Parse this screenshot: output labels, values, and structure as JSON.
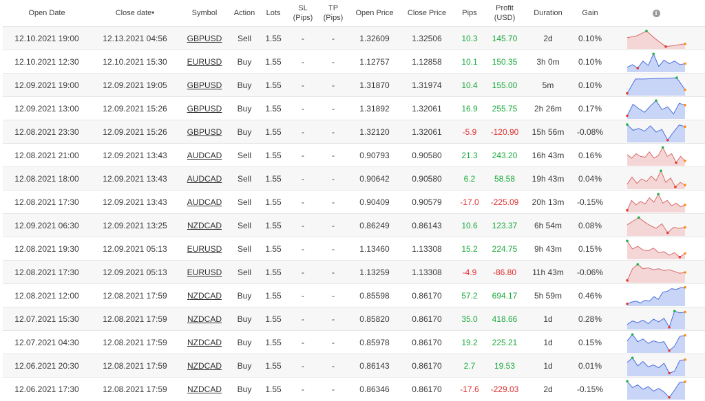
{
  "headers": {
    "open_date": "Open Date",
    "close_date": "Close date",
    "sort_arrow": "▾",
    "symbol": "Symbol",
    "action": "Action",
    "lots": "Lots",
    "sl_1": "SL",
    "sl_2": "(Pips)",
    "tp_1": "TP",
    "tp_2": "(Pips)",
    "open_price": "Open Price",
    "close_price": "Close Price",
    "pips": "Pips",
    "profit_1": "Profit",
    "profit_2": "(USD)",
    "duration": "Duration",
    "gain": "Gain",
    "info_icon": "i"
  },
  "colors": {
    "positive": "#1aaa3c",
    "negative": "#e03030",
    "spark_up_line": "#4a6ee0",
    "spark_up_fill": "#c8d5f7",
    "spark_down_line": "#d86a6a",
    "spark_down_fill": "#f5d6d6"
  },
  "rows": [
    {
      "open": "12.10.2021 19:00",
      "close": "12.13.2021 04:56",
      "symbol": "GBPUSD",
      "action": "Sell",
      "lots": "1.55",
      "sl": "-",
      "tp": "-",
      "open_price": "1.32609",
      "close_price": "1.32506",
      "pips": "10.3",
      "profit": "145.70",
      "duration": "2d",
      "gain": "0.10%",
      "trend": "down",
      "spark": [
        0.55,
        0.65,
        0.92,
        0.45,
        0.05,
        0.12,
        0.2
      ]
    },
    {
      "open": "12.10.2021 12:30",
      "close": "12.10.2021 15:30",
      "symbol": "EURUSD",
      "action": "Buy",
      "lots": "1.55",
      "sl": "-",
      "tp": "-",
      "open_price": "1.12757",
      "close_price": "1.12858",
      "pips": "10.1",
      "profit": "150.35",
      "duration": "3h 0m",
      "gain": "0.10%",
      "trend": "up",
      "spark": [
        0.2,
        0.35,
        0.15,
        0.55,
        0.3,
        0.95,
        0.25,
        0.6,
        0.4,
        0.55,
        0.35,
        0.4
      ]
    },
    {
      "open": "12.09.2021 19:00",
      "close": "12.09.2021 19:05",
      "symbol": "GBPUSD",
      "action": "Buy",
      "lots": "1.55",
      "sl": "-",
      "tp": "-",
      "open_price": "1.31870",
      "close_price": "1.31974",
      "pips": "10.4",
      "profit": "155.00",
      "duration": "5m",
      "gain": "0.10%",
      "trend": "up",
      "spark": [
        0.05,
        0.85,
        0.85,
        0.87,
        0.88,
        0.9,
        0.92,
        0.25
      ]
    },
    {
      "open": "12.09.2021 13:00",
      "close": "12.09.2021 15:26",
      "symbol": "GBPUSD",
      "action": "Buy",
      "lots": "1.55",
      "sl": "-",
      "tp": "-",
      "open_price": "1.31892",
      "close_price": "1.32061",
      "pips": "16.9",
      "profit": "255.75",
      "duration": "2h 26m",
      "gain": "0.17%",
      "trend": "up",
      "spark": [
        0.1,
        0.75,
        0.5,
        0.3,
        0.65,
        0.95,
        0.45,
        0.6,
        0.2,
        0.8,
        0.7
      ]
    },
    {
      "open": "12.08.2021 23:30",
      "close": "12.09.2021 15:26",
      "symbol": "GBPUSD",
      "action": "Buy",
      "lots": "1.55",
      "sl": "-",
      "tp": "-",
      "open_price": "1.32120",
      "close_price": "1.32061",
      "pips": "-5.9",
      "profit": "-120.90",
      "duration": "15h 56m",
      "gain": "-0.08%",
      "trend": "up",
      "spark": [
        0.92,
        0.6,
        0.7,
        0.55,
        0.85,
        0.5,
        0.65,
        0.05,
        0.5,
        0.9,
        0.8
      ]
    },
    {
      "open": "12.08.2021 21:00",
      "close": "12.09.2021 13:43",
      "symbol": "AUDCAD",
      "action": "Sell",
      "lots": "1.55",
      "sl": "-",
      "tp": "-",
      "open_price": "0.90793",
      "close_price": "0.90580",
      "pips": "21.3",
      "profit": "243.20",
      "duration": "16h 43m",
      "gain": "0.16%",
      "trend": "down",
      "spark": [
        0.55,
        0.35,
        0.6,
        0.45,
        0.4,
        0.7,
        0.35,
        0.5,
        0.95,
        0.45,
        0.6,
        0.1,
        0.45,
        0.2
      ]
    },
    {
      "open": "12.08.2021 18:00",
      "close": "12.09.2021 13:43",
      "symbol": "AUDCAD",
      "action": "Sell",
      "lots": "1.55",
      "sl": "-",
      "tp": "-",
      "open_price": "0.90642",
      "close_price": "0.90580",
      "pips": "6.2",
      "profit": "58.58",
      "duration": "19h 43m",
      "gain": "0.04%",
      "trend": "down",
      "spark": [
        0.2,
        0.6,
        0.25,
        0.5,
        0.35,
        0.65,
        0.4,
        0.95,
        0.3,
        0.55,
        0.05,
        0.3,
        0.15
      ]
    },
    {
      "open": "12.08.2021 17:30",
      "close": "12.09.2021 13:43",
      "symbol": "AUDCAD",
      "action": "Sell",
      "lots": "1.55",
      "sl": "-",
      "tp": "-",
      "open_price": "0.90409",
      "close_price": "0.90579",
      "pips": "-17.0",
      "profit": "-225.09",
      "duration": "20h 13m",
      "gain": "-0.15%",
      "trend": "down",
      "spark": [
        0.05,
        0.6,
        0.35,
        0.55,
        0.4,
        0.75,
        0.5,
        0.95,
        0.45,
        0.6,
        0.3,
        0.45,
        0.25,
        0.35
      ]
    },
    {
      "open": "12.09.2021 06:30",
      "close": "12.09.2021 13:25",
      "symbol": "NZDCAD",
      "action": "Sell",
      "lots": "1.55",
      "sl": "-",
      "tp": "-",
      "open_price": "0.86249",
      "close_price": "0.86143",
      "pips": "10.6",
      "profit": "123.37",
      "duration": "6h 54m",
      "gain": "0.08%",
      "trend": "down",
      "spark": [
        0.55,
        0.75,
        0.95,
        0.7,
        0.5,
        0.35,
        0.6,
        0.1,
        0.4,
        0.35,
        0.4
      ]
    },
    {
      "open": "12.08.2021 19:30",
      "close": "12.09.2021 05:13",
      "symbol": "EURUSD",
      "action": "Sell",
      "lots": "1.55",
      "sl": "-",
      "tp": "-",
      "open_price": "1.13460",
      "close_price": "1.13308",
      "pips": "15.2",
      "profit": "224.75",
      "duration": "9h 43m",
      "gain": "0.15%",
      "trend": "down",
      "spark": [
        0.95,
        0.5,
        0.65,
        0.45,
        0.4,
        0.55,
        0.3,
        0.35,
        0.15,
        0.3,
        0.05,
        0.25
      ]
    },
    {
      "open": "12.08.2021 17:30",
      "close": "12.09.2021 05:13",
      "symbol": "EURUSD",
      "action": "Sell",
      "lots": "1.55",
      "sl": "-",
      "tp": "-",
      "open_price": "1.13259",
      "close_price": "1.13308",
      "pips": "-4.9",
      "profit": "-86.80",
      "duration": "11h 43m",
      "gain": "-0.06%",
      "trend": "down",
      "spark": [
        0.05,
        0.7,
        0.95,
        0.7,
        0.75,
        0.65,
        0.7,
        0.6,
        0.65,
        0.55,
        0.45,
        0.5
      ]
    },
    {
      "open": "12.08.2021 12:00",
      "close": "12.08.2021 17:59",
      "symbol": "NZDCAD",
      "action": "Buy",
      "lots": "1.55",
      "sl": "-",
      "tp": "-",
      "open_price": "0.85598",
      "close_price": "0.86170",
      "pips": "57.2",
      "profit": "694.17",
      "duration": "5h 59m",
      "gain": "0.46%",
      "trend": "up",
      "spark": [
        0.05,
        0.15,
        0.2,
        0.1,
        0.25,
        0.2,
        0.45,
        0.3,
        0.7,
        0.75,
        0.9,
        0.85,
        0.95,
        0.97
      ]
    },
    {
      "open": "12.07.2021 15:30",
      "close": "12.08.2021 17:59",
      "symbol": "NZDCAD",
      "action": "Buy",
      "lots": "1.55",
      "sl": "-",
      "tp": "-",
      "open_price": "0.85820",
      "close_price": "0.86170",
      "pips": "35.0",
      "profit": "418.66",
      "duration": "1d",
      "gain": "0.28%",
      "trend": "up",
      "spark": [
        0.2,
        0.4,
        0.3,
        0.45,
        0.25,
        0.5,
        0.35,
        0.55,
        0.05,
        0.95,
        0.85,
        0.9
      ]
    },
    {
      "open": "12.07.2021 04:30",
      "close": "12.08.2021 17:59",
      "symbol": "NZDCAD",
      "action": "Buy",
      "lots": "1.55",
      "sl": "-",
      "tp": "-",
      "open_price": "0.85978",
      "close_price": "0.86170",
      "pips": "19.2",
      "profit": "225.21",
      "duration": "1d",
      "gain": "0.15%",
      "trend": "up",
      "spark": [
        0.6,
        0.95,
        0.55,
        0.7,
        0.45,
        0.6,
        0.5,
        0.55,
        0.05,
        0.3,
        0.85,
        0.9
      ]
    },
    {
      "open": "12.06.2021 20:30",
      "close": "12.08.2021 17:59",
      "symbol": "NZDCAD",
      "action": "Buy",
      "lots": "1.55",
      "sl": "-",
      "tp": "-",
      "open_price": "0.86143",
      "close_price": "0.86170",
      "pips": "2.7",
      "profit": "19.53",
      "duration": "1d",
      "gain": "0.01%",
      "trend": "up",
      "spark": [
        0.7,
        0.95,
        0.5,
        0.75,
        0.45,
        0.55,
        0.4,
        0.65,
        0.1,
        0.2,
        0.8,
        0.85
      ]
    },
    {
      "open": "12.06.2021 17:30",
      "close": "12.08.2021 17:59",
      "symbol": "NZDCAD",
      "action": "Buy",
      "lots": "1.55",
      "sl": "-",
      "tp": "-",
      "open_price": "0.86346",
      "close_price": "0.86170",
      "pips": "-17.6",
      "profit": "-229.03",
      "duration": "2d",
      "gain": "-0.15%",
      "trend": "up",
      "spark": [
        0.95,
        0.6,
        0.75,
        0.5,
        0.65,
        0.4,
        0.55,
        0.35,
        0.05,
        0.45,
        0.9,
        0.92
      ]
    }
  ]
}
